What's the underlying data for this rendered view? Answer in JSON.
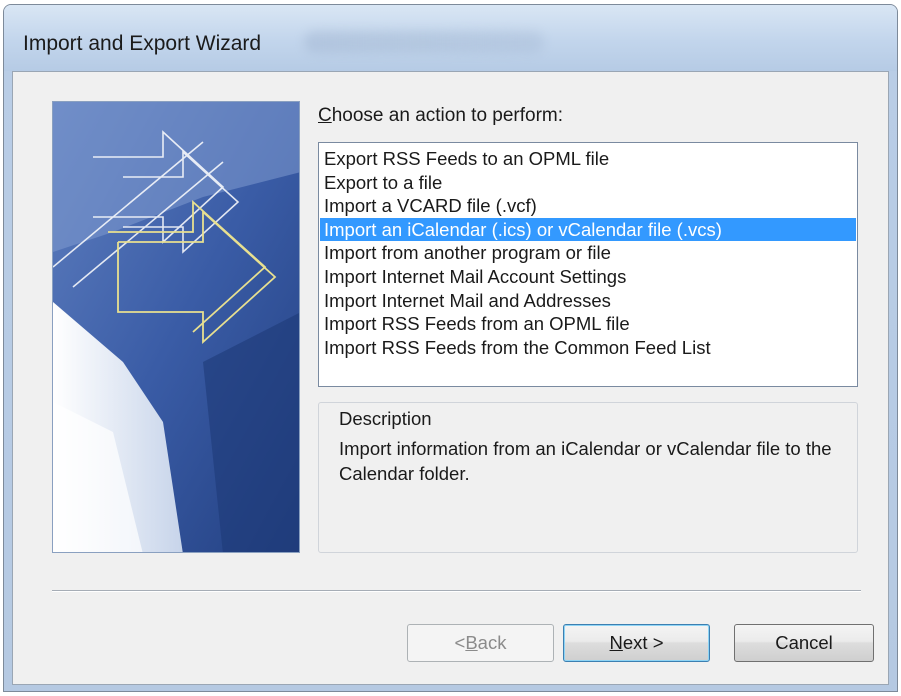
{
  "window": {
    "title": "Import and Export Wizard"
  },
  "prompt": {
    "prefix": "C",
    "rest": "hoose an action to perform:"
  },
  "actions": [
    "Export RSS Feeds to an OPML file",
    "Export to a file",
    "Import a VCARD file (.vcf)",
    "Import an iCalendar (.ics) or vCalendar file (.vcs)",
    "Import from another program or file",
    "Import Internet Mail Account Settings",
    "Import Internet Mail and Addresses",
    "Import RSS Feeds from an OPML file",
    "Import RSS Feeds from the Common Feed List"
  ],
  "selected_action_index": 3,
  "description": {
    "title": "Description",
    "text": "Import information from an iCalendar or vCalendar file to the Calendar folder."
  },
  "buttons": {
    "back": {
      "prefix": "< ",
      "mnemonic": "B",
      "rest": "ack",
      "enabled": false
    },
    "next": {
      "mnemonic": "N",
      "rest": "ext >",
      "enabled": true,
      "default": true
    },
    "cancel": {
      "label": "Cancel",
      "enabled": true
    }
  },
  "colors": {
    "selection": "#3399ff",
    "banner_dark": "#2c4f93",
    "banner_light": "#d8e2f1",
    "banner_arrow": "#e8e090"
  }
}
